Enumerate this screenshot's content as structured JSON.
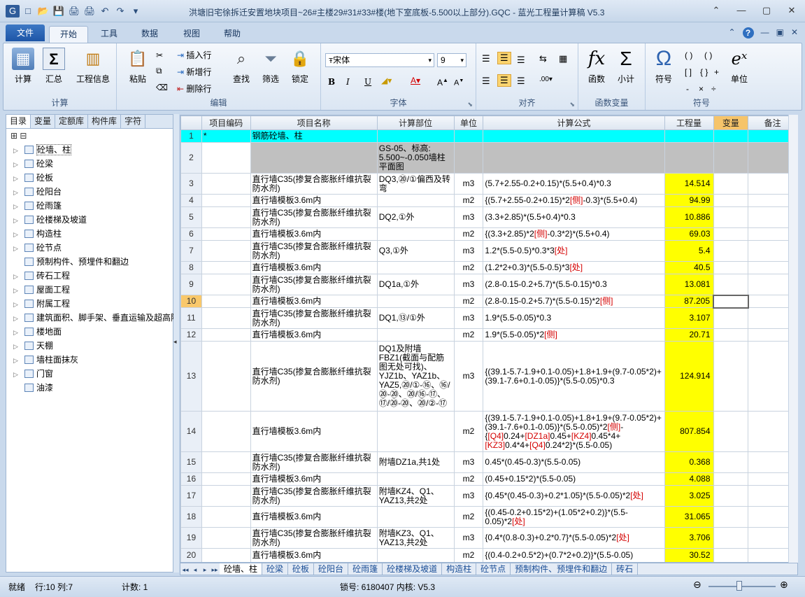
{
  "app_title": "洪塘旧宅徐拆迁安置地块项目~26#主楼29#31#33#楼(地下室底板-5.500以上部分).GQC - 蓝光工程量计算稿 V5.3",
  "quick_access": [
    "G",
    "□",
    "📂",
    "💾",
    "🖨",
    "🖨",
    "↶",
    "↷",
    "▾"
  ],
  "window_buttons": [
    "⌃",
    "—",
    "▢",
    "✕"
  ],
  "menu_tabs": {
    "file": "文件",
    "home": "开始",
    "tools": "工具",
    "data": "数据",
    "view": "视图",
    "help": "帮助"
  },
  "ribbon": {
    "calc_group": {
      "label": "计算",
      "calc": "计算",
      "sum": "汇总",
      "project_info": "工程信息"
    },
    "edit_group": {
      "label": "编辑",
      "paste": "粘贴",
      "insert_row": "插入行",
      "add_row": "新增行",
      "delete_row": "删除行",
      "find": "查找",
      "filter": "筛选",
      "lock": "锁定"
    },
    "font_group": {
      "label": "字体",
      "font_name": "宋体",
      "font_size": "9",
      "bold": "B",
      "italic": "I",
      "underline": "U",
      "grow": "A",
      "shrink": "A"
    },
    "align_group": {
      "label": "对齐"
    },
    "func_group": {
      "label": "函数变量",
      "func": "函数",
      "subtotal": "小计"
    },
    "symbol_group": {
      "label": "符号",
      "symbol": "符号",
      "unit": "单位",
      "b1": "( )",
      "b2": "( )",
      "b3": "[ ]",
      "b4": "{ }",
      "op1": "+",
      "op2": "-",
      "op3": "×",
      "op4": "÷"
    }
  },
  "left_panel": {
    "tabs": [
      "目录",
      "变量",
      "定额库",
      "构件库",
      "字符"
    ],
    "tree": [
      {
        "label": "砼墙、柱",
        "expandable": true,
        "selected": true
      },
      {
        "label": "砼梁",
        "expandable": true
      },
      {
        "label": "砼板",
        "expandable": true
      },
      {
        "label": "砼阳台",
        "expandable": true
      },
      {
        "label": "砼雨篷",
        "expandable": true
      },
      {
        "label": "砼楼梯及坡道",
        "expandable": true
      },
      {
        "label": "构造柱",
        "expandable": true
      },
      {
        "label": "砼节点",
        "expandable": true
      },
      {
        "label": "预制构件、预埋件和翻边",
        "expandable": false
      },
      {
        "label": "砖石工程",
        "expandable": true
      },
      {
        "label": "屋面工程",
        "expandable": true
      },
      {
        "label": "附属工程",
        "expandable": true
      },
      {
        "label": "建筑面积、脚手架、垂直运输及超高降",
        "expandable": true
      },
      {
        "label": "楼地面",
        "expandable": true
      },
      {
        "label": "天棚",
        "expandable": true
      },
      {
        "label": "墙柱面抹灰",
        "expandable": true
      },
      {
        "label": "门窗",
        "expandable": true
      },
      {
        "label": "油漆",
        "expandable": false
      }
    ]
  },
  "grid": {
    "headers": [
      "",
      "项目编码",
      "项目名称",
      "计算部位",
      "单位",
      "计算公式",
      "工程量",
      "变量",
      "备注"
    ],
    "rows": [
      {
        "n": "1",
        "code": "*",
        "name": "钢筋砼墙、柱",
        "part": "",
        "unit": "",
        "formula": "",
        "qty": "",
        "type": "section"
      },
      {
        "n": "2",
        "code": "",
        "name": "",
        "part": "GS-05、标高: 5.500~-0.050墙柱平面图",
        "unit": "",
        "formula": "",
        "qty": "",
        "type": "note"
      },
      {
        "n": "3",
        "code": "",
        "name": "直行墙C35(掺复合膨胀纤维抗裂防水剂)",
        "part": "DQ3,⑳/①偏西及转弯",
        "unit": "m3",
        "formula": "(5.7+2.55-0.2+0.15)*(5.5+0.4)*0.3",
        "qty": "14.514"
      },
      {
        "n": "4",
        "code": "",
        "name": "直行墙模板3.6m内",
        "part": "",
        "unit": "m2",
        "formula": "{(5.7+2.55-0.2+0.15)*2[侧]-0.3}*(5.5+0.4)",
        "qty": "94.99"
      },
      {
        "n": "5",
        "code": "",
        "name": "直行墙C35(掺复合膨胀纤维抗裂防水剂)",
        "part": "DQ2,①外",
        "unit": "m3",
        "formula": "(3.3+2.85)*(5.5+0.4)*0.3",
        "qty": "10.886"
      },
      {
        "n": "6",
        "code": "",
        "name": "直行墙模板3.6m内",
        "part": "",
        "unit": "m2",
        "formula": "{(3.3+2.85)*2[侧]-0.3*2}*(5.5+0.4)",
        "qty": "69.03"
      },
      {
        "n": "7",
        "code": "",
        "name": "直行墙C35(掺复合膨胀纤维抗裂防水剂)",
        "part": "Q3,①外",
        "unit": "m3",
        "formula": "1.2*(5.5-0.5)*0.3*3[处]",
        "qty": "5.4"
      },
      {
        "n": "8",
        "code": "",
        "name": "直行墙模板3.6m内",
        "part": "",
        "unit": "m2",
        "formula": "(1.2*2+0.3)*(5.5-0.5)*3[处]",
        "qty": "40.5"
      },
      {
        "n": "9",
        "code": "",
        "name": "直行墙C35(掺复合膨胀纤维抗裂防水剂)",
        "part": "DQ1a,①外",
        "unit": "m3",
        "formula": "(2.8-0.15-0.2+5.7)*(5.5-0.15)*0.3",
        "qty": "13.081"
      },
      {
        "n": "10",
        "code": "",
        "name": "直行墙模板3.6m内",
        "part": "",
        "unit": "m2",
        "formula": "(2.8-0.15-0.2+5.7)*(5.5-0.15)*2[侧]",
        "qty": "87.205",
        "current": true
      },
      {
        "n": "11",
        "code": "",
        "name": "直行墙C35(掺复合膨胀纤维抗裂防水剂)",
        "part": "DQ1,⑬/①外",
        "unit": "m3",
        "formula": "1.9*(5.5-0.05)*0.3",
        "qty": "3.107"
      },
      {
        "n": "12",
        "code": "",
        "name": "直行墙模板3.6m内",
        "part": "",
        "unit": "m2",
        "formula": "1.9*(5.5-0.05)*2[侧]",
        "qty": "20.71"
      },
      {
        "n": "13",
        "code": "",
        "name": "直行墙C35(掺复合膨胀纤维抗裂防水剂)",
        "part": "DQ1及附墙FBZ1(截面与配筋图无处可找)、YJZ1b、YAZ1b、YAZ5,⑳/①-⑯、⑯/⑳-⑳、⑳/⑯-⑰、⑰/⑳-⑳、⑳/②-⑰",
        "unit": "m3",
        "formula": "{(39.1-5.7-1.9+0.1-0.05)+1.8+1.9+(9.7-0.05*2)+(39.1-7.6+0.1-0.05)}*(5.5-0.05)*0.3",
        "qty": "124.914"
      },
      {
        "n": "14",
        "code": "",
        "name": "直行墙模板3.6m内",
        "part": "",
        "unit": "m2",
        "formula": "{(39.1-5.7-1.9+0.1-0.05)+1.8+1.9+(9.7-0.05*2)+(39.1-7.6+0.1-0.05)}*(5.5-0.05)*2[侧]-{[Q4]0.24+[DZ1a]0.45+[KZ4]0.45*4+[KZ3]0.4*4+[Q4]0.24*2}*(5.5-0.05)",
        "qty": "807.854"
      },
      {
        "n": "15",
        "code": "",
        "name": "直行墙C35(掺复合膨胀纤维抗裂防水剂)",
        "part": "附墙DZ1a,共1处",
        "unit": "m3",
        "formula": "0.45*(0.45-0.3)*(5.5-0.05)",
        "qty": "0.368"
      },
      {
        "n": "16",
        "code": "",
        "name": "直行墙模板3.6m内",
        "part": "",
        "unit": "m2",
        "formula": "(0.45+0.15*2)*(5.5-0.05)",
        "qty": "4.088"
      },
      {
        "n": "17",
        "code": "",
        "name": "直行墙C35(掺复合膨胀纤维抗裂防水剂)",
        "part": "附墙KZ4、Q1、YAZ13,共2处",
        "unit": "m3",
        "formula": "{0.45*(0.45-0.3)+0.2*1.05}*(5.5-0.05)*2[处]",
        "qty": "3.025"
      },
      {
        "n": "18",
        "code": "",
        "name": "直行墙模板3.6m内",
        "part": "",
        "unit": "m2",
        "formula": "{(0.45-0.2+0.15*2)+(1.05*2+0.2)}*(5.5-0.05)*2[处]",
        "qty": "31.065"
      },
      {
        "n": "19",
        "code": "",
        "name": "直行墙C35(掺复合膨胀纤维抗裂防水剂)",
        "part": "附墙KZ3、Q1、YAZ13,共2处",
        "unit": "m3",
        "formula": "{0.4*(0.8-0.3)+0.2*0.7}*(5.5-0.05)*2[处]",
        "qty": "3.706"
      },
      {
        "n": "20",
        "code": "",
        "name": "直行墙模板3.6m内",
        "part": "",
        "unit": "m2",
        "formula": "{(0.4-0.2+0.5*2)+(0.7*2+0.2)}*(5.5-0.05)",
        "qty": "30.52"
      }
    ]
  },
  "sheet_tabs": [
    "砼墙、柱",
    "砼梁",
    "砼板",
    "砼阳台",
    "砼雨篷",
    "砼楼梯及坡道",
    "构造柱",
    "砼节点",
    "预制构件、预埋件和翻边",
    "砖石"
  ],
  "status": {
    "ready": "就绪",
    "position": "行:10 列:7",
    "count": "计数: 1",
    "lock": "锁号: 6180407 内核: V5.3"
  },
  "colors": {
    "section_row": "#00ffff",
    "note_row": "#c0c0c0",
    "qty_cell": "#ffff00",
    "formula_tag": "#d40000",
    "current_row": "#f9c86b"
  }
}
